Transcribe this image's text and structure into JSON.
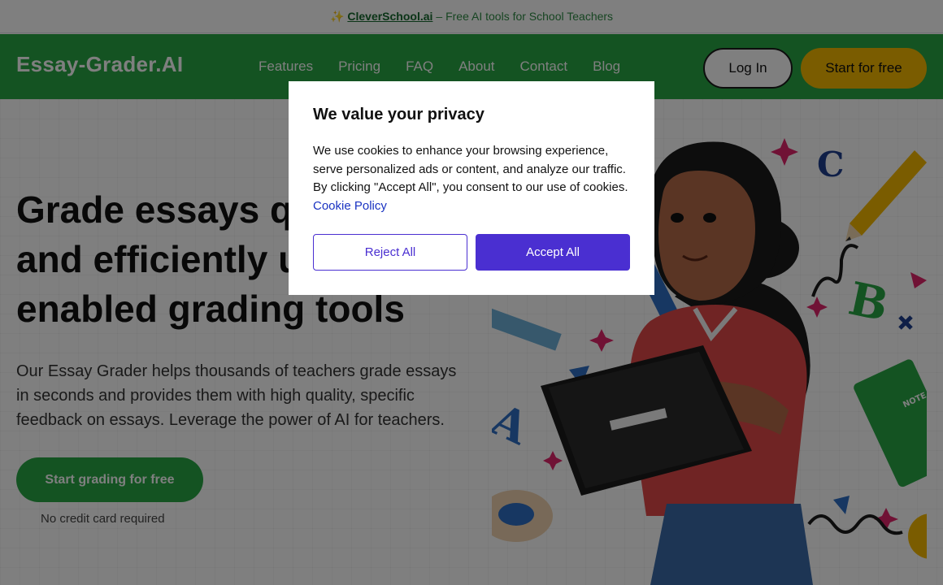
{
  "announcement": {
    "sparkle": "✨",
    "link_text": "CleverSchool.ai",
    "rest_text": "– Free AI tools for School Teachers"
  },
  "header": {
    "logo": "Essay-Grader.AI",
    "nav": [
      "Features",
      "Pricing",
      "FAQ",
      "About",
      "Contact",
      "Blog"
    ],
    "login_label": "Log In",
    "start_label": "Start for free"
  },
  "hero": {
    "headline": "Grade essays quickly and efficiently using AI-enabled grading tools",
    "subtext": "Our Essay Grader helps thousands of teachers grade essays in seconds and provides them with high quality, specific feedback on essays. Leverage the power of AI for teachers.",
    "cta_label": "Start grading for free",
    "cta_note": "No credit card required"
  },
  "cookie_modal": {
    "title": "We value your privacy",
    "body": "We use cookies to enhance your browsing experience, serve personalized ads or content, and analyze our traffic. By clicking \"Accept All\", you consent to our use of cookies.",
    "policy_link": "Cookie Policy",
    "reject_label": "Reject All",
    "accept_label": "Accept All"
  },
  "illustration": {
    "letters": [
      "C",
      "B",
      "A"
    ],
    "notebook_label": "NOTE"
  },
  "colors": {
    "brand_green": "#28a745",
    "accent_yellow": "#f5b800",
    "consent_purple": "#4a2fd1"
  }
}
